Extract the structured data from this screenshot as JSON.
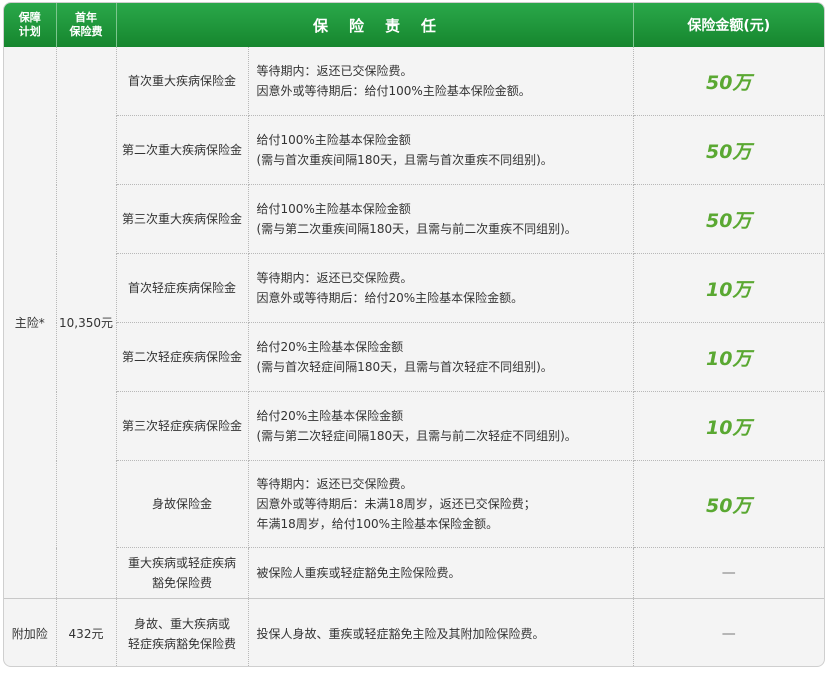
{
  "header": {
    "plan_line1": "保障",
    "plan_line2": "计划",
    "premium_line1": "首年",
    "premium_line2": "保险费",
    "responsibility": "保险责任",
    "amount": "保险金额(元)"
  },
  "main_plan": {
    "name": "主险*",
    "premium": "10,350元",
    "rows": [
      {
        "item": "首次重大疾病保险金",
        "desc": [
          "等待期内：返还已交保险费。",
          "因意外或等待期后：给付100%主险基本保险金额。"
        ],
        "amount": "50万"
      },
      {
        "item": "第二次重大疾病保险金",
        "desc": [
          "给付100%主险基本保险金额",
          "(需与首次重疾间隔180天，且需与首次重疾不同组别)。"
        ],
        "amount": "50万"
      },
      {
        "item": "第三次重大疾病保险金",
        "desc": [
          "给付100%主险基本保险金额",
          "(需与第二次重疾间隔180天，且需与前二次重疾不同组别)。"
        ],
        "amount": "50万"
      },
      {
        "item": "首次轻症疾病保险金",
        "desc": [
          "等待期内：返还已交保险费。",
          "因意外或等待期后：给付20%主险基本保险金额。"
        ],
        "amount": "10万"
      },
      {
        "item": "第二次轻症疾病保险金",
        "desc": [
          "给付20%主险基本保险金额",
          "(需与首次轻症间隔180天，且需与首次轻症不同组别)。"
        ],
        "amount": "10万"
      },
      {
        "item": "第三次轻症疾病保险金",
        "desc": [
          "给付20%主险基本保险金额",
          "(需与第二次轻症间隔180天，且需与前二次轻症不同组别)。"
        ],
        "amount": "10万"
      },
      {
        "item": "身故保险金",
        "desc": [
          "等待期内：返还已交保险费。",
          "因意外或等待期后：未满18周岁，返还已交保险费；",
          "年满18周岁，给付100%主险基本保险金额。"
        ],
        "amount": "50万"
      },
      {
        "item_lines": [
          "重大疾病或轻症疾病",
          "豁免保险费"
        ],
        "desc": [
          "被保险人重疾或轻症豁免主险保险费。"
        ],
        "amount": "—"
      }
    ]
  },
  "rider_plan": {
    "name": "附加险",
    "premium": "432元",
    "item_lines": [
      "身故、重大疾病或",
      "轻症疾病豁免保险费"
    ],
    "desc": [
      "投保人身故、重疾或轻症豁免主险及其附加险保险费。"
    ],
    "amount": "—"
  },
  "colors": {
    "header_green": "#1f9a3d",
    "amount_green": "#5aa832"
  }
}
